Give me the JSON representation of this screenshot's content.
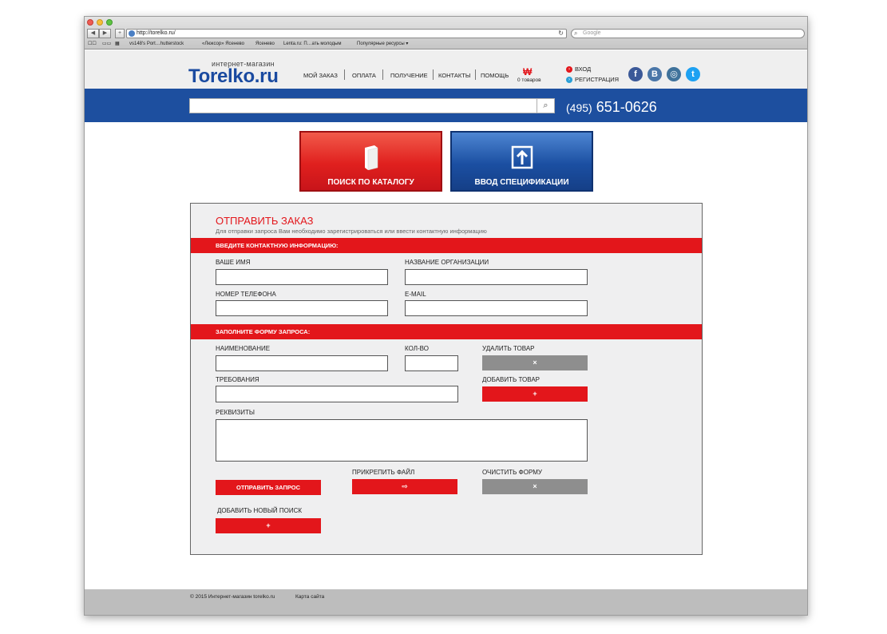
{
  "browser": {
    "url": "http://torelko.ru/",
    "search_placeholder": "Google",
    "back": "◀",
    "forward": "▶",
    "add_tab": "+",
    "bookmarks": [
      "vs148's Port…hutterstock",
      "«Люксор» Ясенево",
      "Ясенево",
      "Lenta.ru: П…ать молодым",
      "Популярные ресурсы ▾"
    ]
  },
  "header": {
    "logo_sub": "интернет-магазин",
    "logo": "Torelko.ru",
    "menu": [
      "МОЙ ЗАКАЗ",
      "ОПЛАТА",
      "ПОЛУЧЕНИЕ",
      "КОНТАКТЫ",
      "ПОМОЩЬ"
    ],
    "cart_count": "0 товаров",
    "login": "ВХОД",
    "register": "РЕГИСТРАЦИЯ",
    "social": [
      {
        "icon": "facebook-icon",
        "glyph": "f",
        "color": "#3b5998"
      },
      {
        "icon": "vk-icon",
        "glyph": "В",
        "color": "#4a76a8"
      },
      {
        "icon": "instagram-icon",
        "glyph": "◎",
        "color": "#3f729b"
      },
      {
        "icon": "twitter-icon",
        "glyph": "t",
        "color": "#1da1f2"
      }
    ]
  },
  "searchbar": {
    "phone_code": "(495)",
    "phone_number": "651-0626"
  },
  "big_buttons": {
    "catalog": "ПОИСК ПО КАТАЛОГУ",
    "spec": "ВВОД СПЕЦИФИКАЦИИ"
  },
  "form": {
    "title": "ОТПРАВИТЬ ЗАКАЗ",
    "subtitle": "Для отправки запроса Вам необходимо зарегистрироваться или ввести контактную информацию",
    "section_contact": "ВВЕДИТЕ КОНТАКТНУЮ ИНФОРМАЦИЮ:",
    "name_label": "ВАШЕ ИМЯ",
    "org_label": "НАЗВАНИЕ ОРГАНИЗАЦИИ",
    "phone_label": "НОМЕР ТЕЛЕФОНА",
    "email_label": "E-MAIL",
    "section_request": "ЗАПОЛНИТЕ ФОРМУ ЗАПРОСА:",
    "item_label": "НАИМЕНОВАНИЕ",
    "qty_label": "КОЛ-ВО",
    "delete_label": "УДАЛИТЬ ТОВАР",
    "requirements_label": "ТРЕБОВАНИЯ",
    "add_item_label": "ДОБАВИТЬ ТОВАР",
    "details_label": "РЕКВИЗИТЫ",
    "attach_label": "ПРИКРЕПИТЬ ФАЙЛ",
    "clear_label": "ОЧИСТИТЬ ФОРМУ",
    "submit_button": "ОТПРАВИТЬ ЗАПРОС",
    "new_search_label": "ДОБАВИТЬ НОВЫЙ ПОИСК",
    "x_glyph": "×",
    "plus_glyph": "+",
    "attach_glyph": "⇨"
  },
  "footer": {
    "copyright": "© 2015 Интернет-магазин torelko.ru",
    "sitemap": "Карта сайта"
  },
  "colors": {
    "brand_red": "#e3161b",
    "brand_blue": "#1d4f9f",
    "gray_button": "#8e8e8e"
  }
}
